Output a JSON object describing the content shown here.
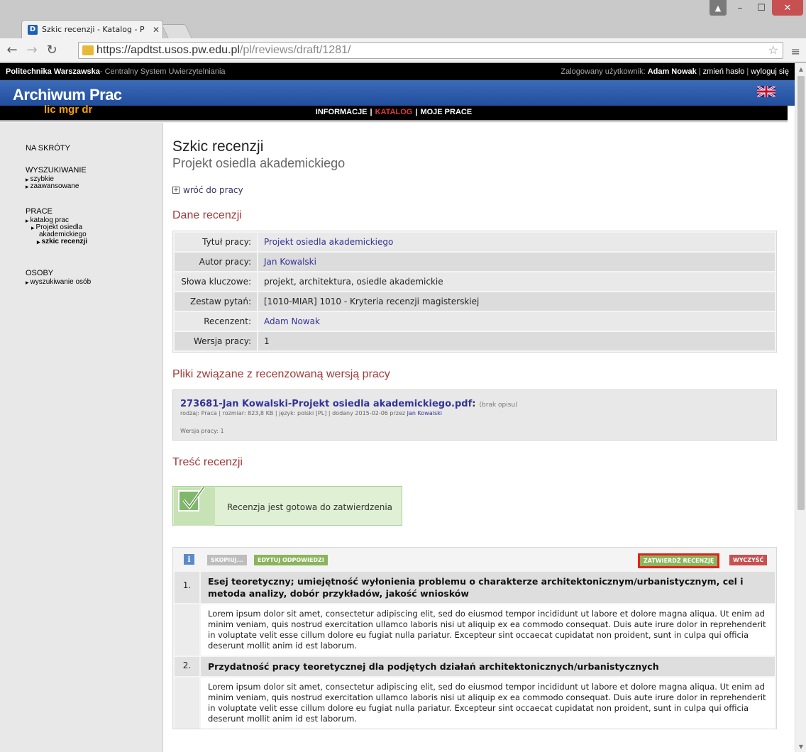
{
  "browser": {
    "tab_title": "Szkic recenzji - Katalog - P",
    "tab_favicon": "D",
    "url_scheme": "https://apdtst.usos.pw.edu.pl",
    "url_path": "/pl/reviews/draft/1281/"
  },
  "topbar": {
    "org": "Politechnika Warszawska",
    "org_sub": " - Centralny System Uwierzytelniania",
    "logged_label": "Zalogowany użytkownik: ",
    "user": "Adam Nowak",
    "change_password": "zmień hasło",
    "logout": "wyloguj się"
  },
  "banner": {
    "logo": "Archiwum Prac",
    "sublogo": "lic mgr dr",
    "nav": [
      "INFORMACJE",
      "KATALOG",
      "MOJE PRACE"
    ],
    "active_nav": "KATALOG"
  },
  "sidebar": {
    "shortcuts": "NA SKRÓTY",
    "search_title": "WYSZUKIWANIE",
    "search_items": [
      "szybkie",
      "zaawansowane"
    ],
    "works_title": "PRACE",
    "works_items": [
      "katalog prac",
      "Projekt osiedla",
      "akademickiego",
      "szkic recenzji"
    ],
    "people_title": "OSOBY",
    "people_items": [
      "wyszukiwanie osób"
    ]
  },
  "main": {
    "title": "Szkic recenzji",
    "subtitle": "Projekt osiedla akademickiego",
    "back_link": "wróć do pracy",
    "review_data_title": "Dane recenzji",
    "meta": [
      {
        "label": "Tytuł pracy:",
        "value": "Projekt osiedla akademickiego"
      },
      {
        "label": "Autor pracy:",
        "value": "Jan Kowalski"
      },
      {
        "label": "Słowa kluczowe:",
        "value": "projekt, architektura, osiedle akademickie"
      },
      {
        "label": "Zestaw pytań:",
        "value": "[1010-MIAR] 1010 - Kryteria recenzji magisterskiej"
      },
      {
        "label": "Recenzent:",
        "value": "Adam Nowak"
      },
      {
        "label": "Wersja pracy:",
        "value": "1"
      }
    ],
    "files_title": "Pliki związane z recenzowaną wersją pracy",
    "file": {
      "name": "273681-Jan Kowalski-Projekt osiedla akademickiego.pdf",
      "colon": ":",
      "desc": "(brak opisu)",
      "meta": "rodzaj: Praca | rozmiar: 823,8 KB | język: polski [PL] | dodany 2015-02-06 przez ",
      "author": "Jan Kowalski",
      "version": "Wersja pracy: 1"
    },
    "content_title": "Treść recenzji",
    "ready_text": "Recenzja jest gotowa do zatwierdzenia",
    "buttons": {
      "info": "i",
      "copy": "SKOPIUJ...",
      "edit": "EDYTUJ ODPOWIEDZI",
      "approve": "ZATWIERDŹ RECENZJĘ",
      "clear": "WYCZYŚĆ"
    },
    "questions": [
      {
        "num": "1.",
        "text": "Esej teoretyczny; umiejętność wyłonienia problemu o charakterze architektonicznym/urbanistycznym, cel i metoda analizy, dobór przykładów, jakość wniosków",
        "answer": "Lorem ipsum dolor sit amet, consectetur adipiscing elit, sed do eiusmod tempor incididunt ut labore et dolore magna aliqua. Ut enim ad minim veniam, quis nostrud exercitation ullamco laboris nisi ut aliquip ex ea commodo consequat. Duis aute irure dolor in reprehenderit in voluptate velit esse cillum dolore eu fugiat nulla pariatur. Excepteur sint occaecat cupidatat non proident, sunt in culpa qui officia deserunt mollit anim id est laborum."
      },
      {
        "num": "2.",
        "text": "Przydatność pracy teoretycznej dla podjętych działań architektonicznych/urbanistycznych",
        "answer": "Lorem ipsum dolor sit amet, consectetur adipiscing elit, sed do eiusmod tempor incididunt ut labore et dolore magna aliqua. Ut enim ad minim veniam, quis nostrud exercitation ullamco laboris nisi ut aliquip ex ea commodo consequat. Duis aute irure dolor in reprehenderit in voluptate velit esse cillum dolore eu fugiat nulla pariatur. Excepteur sint occaecat cupidatat non proident, sunt in culpa qui officia deserunt mollit anim id est laborum."
      }
    ]
  },
  "colors": {
    "accent_red": "#a03a3a",
    "link_blue": "#333399",
    "approve_border": "#e3211d"
  }
}
